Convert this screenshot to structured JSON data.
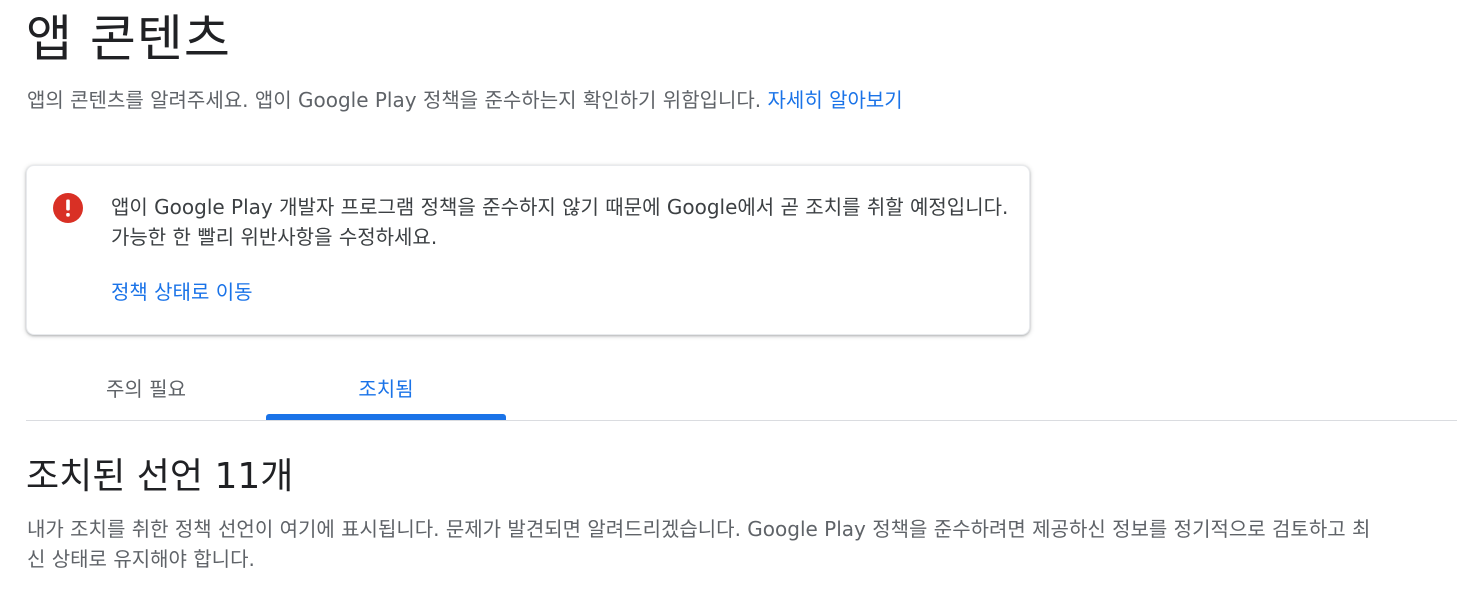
{
  "header": {
    "title": "앱 콘텐츠",
    "description": "앱의 콘텐츠를 알려주세요. 앱이 Google Play 정책을 준수하는지 확인하기 위함입니다.",
    "learn_more_link": "자세히 알아보기"
  },
  "alert": {
    "icon": "error-icon",
    "icon_color": "#d93025",
    "message": "앱이 Google Play 개발자 프로그램 정책을 준수하지 않기 때문에 Google에서 곧 조치를 취할 예정입니다. 가능한 한 빨리 위반사항을 수정하세요.",
    "link": "정책 상태로 이동"
  },
  "tabs": [
    {
      "label": "주의 필요",
      "selected": false
    },
    {
      "label": "조치됨",
      "selected": true
    }
  ],
  "section": {
    "title": "조치된 선언 11개",
    "description": "내가 조치를 취한 정책 선언이 여기에 표시됩니다. 문제가 발견되면 알려드리겠습니다. Google Play 정책을 준수하려면 제공하신 정보를 정기적으로 검토하고 최신 상태로 유지해야 합니다."
  },
  "colors": {
    "accent": "#1a73e8",
    "error": "#d93025",
    "text_primary": "#202124",
    "text_secondary": "#5f6368"
  }
}
